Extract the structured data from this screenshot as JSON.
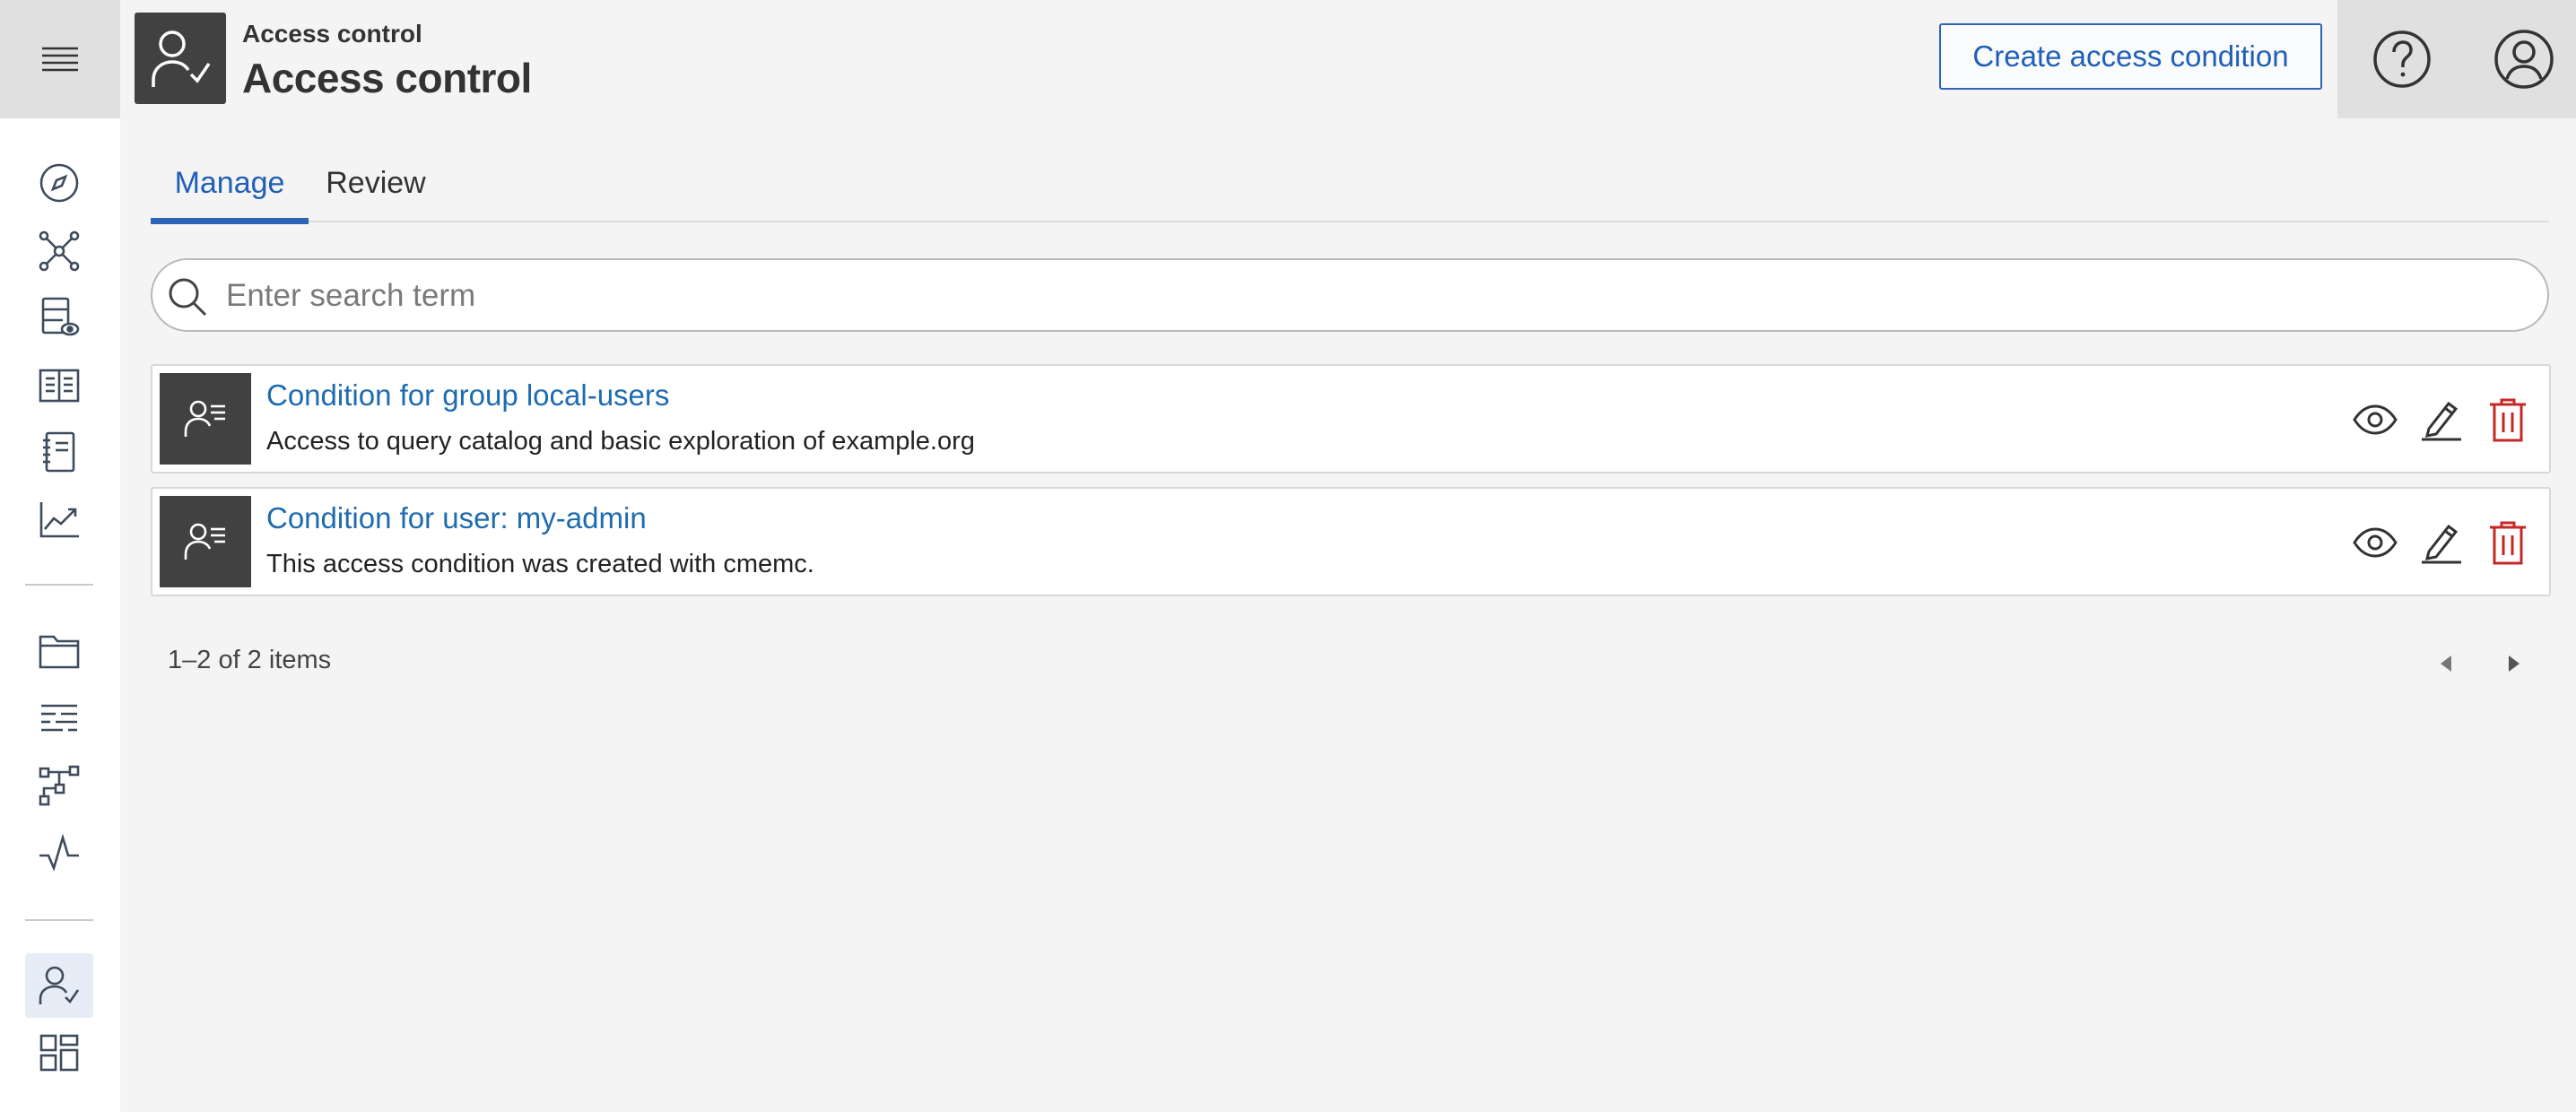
{
  "header": {
    "breadcrumb": "Access control",
    "title": "Access control",
    "create_button_label": "Create access condition"
  },
  "tabs": [
    {
      "label": "Manage",
      "active": true
    },
    {
      "label": "Review",
      "active": false
    }
  ],
  "search": {
    "placeholder": "Enter search term",
    "value": ""
  },
  "conditions": [
    {
      "title": "Condition for group local-users",
      "description": "Access to query catalog and basic exploration of example.org"
    },
    {
      "title": "Condition for user: my-admin",
      "description": "This access condition was created with cmemc."
    }
  ],
  "pagination": {
    "label": "1–2 of 2 items"
  },
  "sidebar": {
    "items": [
      {
        "icon": "explore-icon"
      },
      {
        "icon": "knowledge-graph-icon"
      },
      {
        "icon": "query-catalog-icon"
      },
      {
        "icon": "vocabulary-catalog-icon"
      },
      {
        "icon": "thesaurus-icon"
      },
      {
        "icon": "charts-icon"
      },
      {
        "icon": "folder-icon"
      },
      {
        "icon": "text-lines-icon"
      },
      {
        "icon": "workflow-icon"
      },
      {
        "icon": "activity-icon"
      },
      {
        "icon": "access-control-icon",
        "active": true
      },
      {
        "icon": "dashboard-icon"
      }
    ]
  },
  "colors": {
    "accent": "#2d63b8",
    "link": "#1e6bb0",
    "delete": "#c62828",
    "icon_tile": "#414141"
  }
}
